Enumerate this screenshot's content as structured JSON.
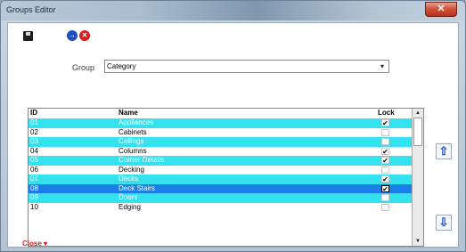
{
  "window": {
    "title": "Groups Editor",
    "close_glyph": "✕"
  },
  "toolbar": {
    "save_icon": "save-icon",
    "add_icon": "add-icon",
    "delete_icon": "delete-icon",
    "add_glyph": "→",
    "delete_glyph": "✕"
  },
  "group": {
    "label": "Group",
    "selected": "Category",
    "arrow": "▾"
  },
  "grid": {
    "columns": [
      "ID",
      "Name",
      "Lock"
    ],
    "rows": [
      {
        "id": "01",
        "name": "Appliances",
        "lock": "✔",
        "style": "cyan"
      },
      {
        "id": "02",
        "name": "Cabinets",
        "lock": "",
        "style": "white"
      },
      {
        "id": "03",
        "name": "Ceilings",
        "lock": "",
        "style": "cyan"
      },
      {
        "id": "04",
        "name": "Columns",
        "lock": "✔",
        "style": "white"
      },
      {
        "id": "05",
        "name": "Corner Details",
        "lock": "✔",
        "style": "cyan"
      },
      {
        "id": "06",
        "name": "Decking",
        "lock": "",
        "style": "white"
      },
      {
        "id": "07",
        "name": "Decks",
        "lock": "✔",
        "style": "cyan"
      },
      {
        "id": "08",
        "name": "Deck Stairs",
        "lock": "✔",
        "style": "selected"
      },
      {
        "id": "09",
        "name": "Doors",
        "lock": "",
        "style": "cyan"
      },
      {
        "id": "10",
        "name": "Edging",
        "lock": "",
        "style": "white"
      }
    ],
    "scroll_up": "▲",
    "scroll_down": "▼"
  },
  "side": {
    "move_up_icon": "arrow-up-icon",
    "move_down_icon": "arrow-down-icon",
    "up_glyph": "⇧",
    "down_glyph": "⇩"
  },
  "footer": {
    "close_label": "Close ▾"
  },
  "colors": {
    "row_cyan": "#34e1ee",
    "row_selected": "#1a7ee8",
    "close_red": "#d21e1e",
    "add_blue": "#1b4fc8"
  }
}
